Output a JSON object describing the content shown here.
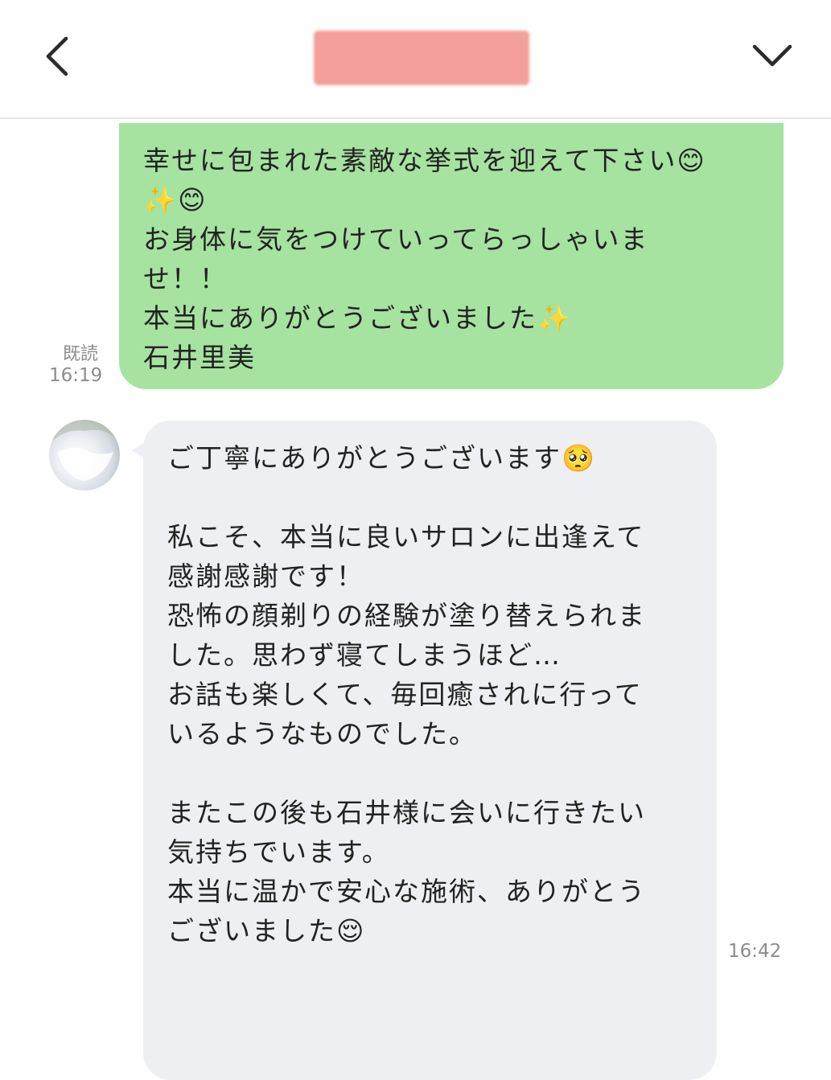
{
  "header": {
    "back_icon": "chevron-left-icon",
    "menu_icon": "chevron-down-icon"
  },
  "messages": [
    {
      "direction": "sent",
      "text": "幸せに包まれた素敵な挙式を迎えて下さい😊\n✨😊\nお身体に気をつけていってらっしゃいま\nせ！！\n本当にありがとうございました✨\n石井里美",
      "status": "既読",
      "time": "16:19"
    },
    {
      "direction": "received",
      "text": "ご丁寧にありがとうございます🥺\n\n私こそ、本当に良いサロンに出逢えて\n感謝感謝です！\n恐怖の顔剃りの経験が塗り替えられま\nした。思わず寝てしまうほど…\nお話も楽しくて、毎回癒されに行って\nいるようなものでした。\n\nまたこの後も石井様に会いに行きたい\n気持ちでいます。\n本当に温かで安心な施術、ありがとう\nございました😌",
      "time": "16:42"
    }
  ],
  "colors": {
    "sent_bubble": "#a6e2a0",
    "received_bubble": "#eeeff2",
    "meta_text": "#8c8c8c",
    "redaction": "#f49a94"
  }
}
